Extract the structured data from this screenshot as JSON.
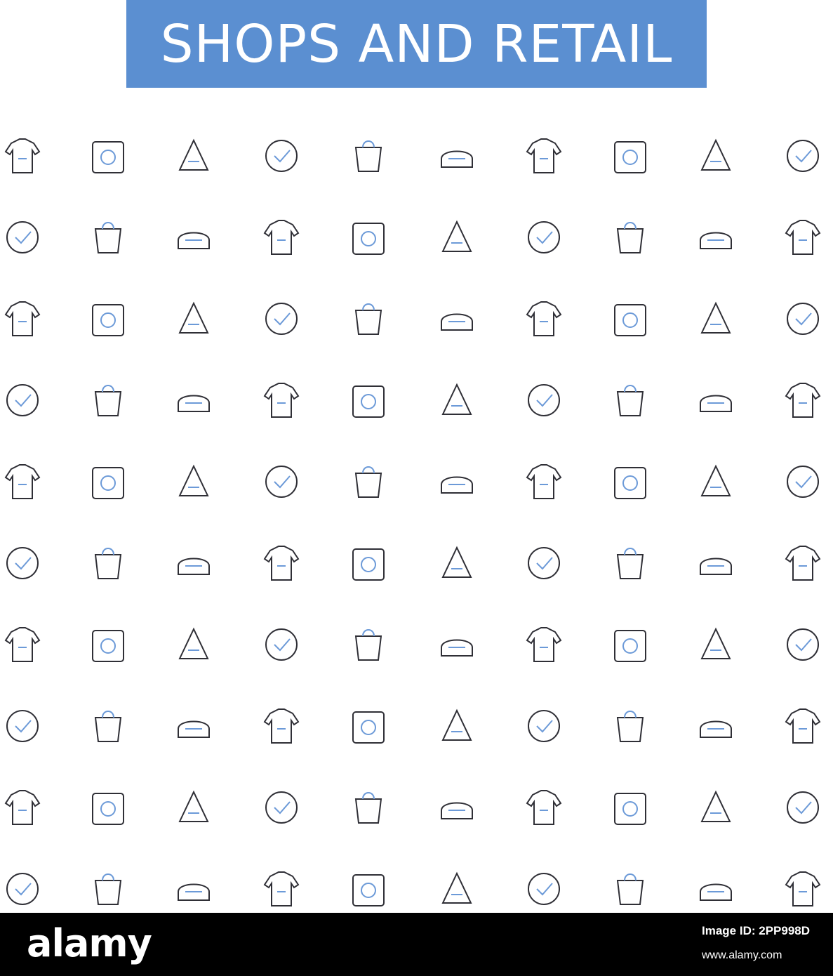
{
  "banner": {
    "title": "SHOPS AND RETAIL"
  },
  "colors": {
    "banner": "#5b8fd1",
    "stroke_dark": "#2f2f36",
    "stroke_accent": "#6c9ad8",
    "footer": "#000000"
  },
  "icons": [
    [
      "sweater-icon",
      "scissors-brush-icon",
      "banknote-icon",
      "shorts-icon",
      "mirror-makeup-icon",
      "courier-box-icon",
      "necktie-icon",
      "trousers-icon",
      "discount-badge-icon",
      "swimsuit-icon"
    ],
    [
      "vest-icon",
      "blazer-icon",
      "glasses-icon",
      "coins-money-icon",
      "hoodie-icon",
      "boots-icon",
      "computer-laptop-icon",
      "overalls-icon",
      "online-shop-icon",
      "skirt-icon"
    ],
    [
      "calculator-icon",
      "hat-icon",
      "belt-icon",
      "airplane-icon",
      "error-404-icon",
      "shopping-bag-icon",
      "baby-romper-icon",
      "delivery-box-icon",
      "card-terminal-icon",
      "puffer-jacket-icon"
    ],
    [
      "profile-badge-icon",
      "shirt-icon",
      "newspaper-icon",
      "delivery-truck-icon",
      "price-tag-icon",
      "phone-clock-icon",
      "new-badge-icon",
      "wallet-icon",
      "shopping-cart-icon",
      "gift-box-icon"
    ],
    [
      "boxing-gloves-icon",
      "jersey-icon",
      "sneaker-icon",
      "sock-icon",
      "yarn-ball-icon",
      "scarf-icon",
      "mittens-icon",
      "knitting-sock-icon",
      "dress-icon",
      "snowflake-sweater-icon"
    ],
    [
      "goggles-icon",
      "polo-sneaker-icon",
      "tall-boots-icon",
      "tshirt-icon",
      "panties-icon",
      "cap-icon",
      "handbag-icon",
      "coat-icon",
      "running-shoe-icon",
      "bikini-icon"
    ],
    [
      "pullover-icon",
      "slip-dress-icon",
      "socks-icon",
      "trench-coat-icon",
      "flared-skirt-icon",
      "leggings-icon",
      "gloves-icon",
      "knit-sweater-icon",
      "saleswoman-icon",
      "polo-shirt-icon"
    ],
    [
      "boot-icon",
      "baby-overalls-icon",
      "a-line-skirt-icon",
      "party-dress-icon",
      "fedora-icon",
      "belt-buckle-icon",
      "baby-bodysuit-icon",
      "jacket-icon",
      "ties-hanger-icon",
      "businessman-icon"
    ],
    [
      "woman-suit-icon",
      "man-tie-icon",
      "suit-briefcase-icon",
      "bandana-icon",
      "rain-boots-icon",
      "scarecrow-icon",
      "farmer-icon",
      "apron-icon",
      "work-gloves-icon",
      "shopper-woman-icon"
    ],
    [
      "sleep-mask-icon",
      "ugly-sweater-icon",
      "wedding-couple-icon",
      "native-headdress-icon",
      "winter-mitten-icon",
      "oven-mitts-icon",
      "christmas-stocking-icon",
      "builder-icon",
      "fur-coat-icon",
      "detective-icon"
    ]
  ],
  "footer": {
    "brand": "alamy",
    "image_id": "Image ID: 2PP998D",
    "url": "www.alamy.com"
  }
}
